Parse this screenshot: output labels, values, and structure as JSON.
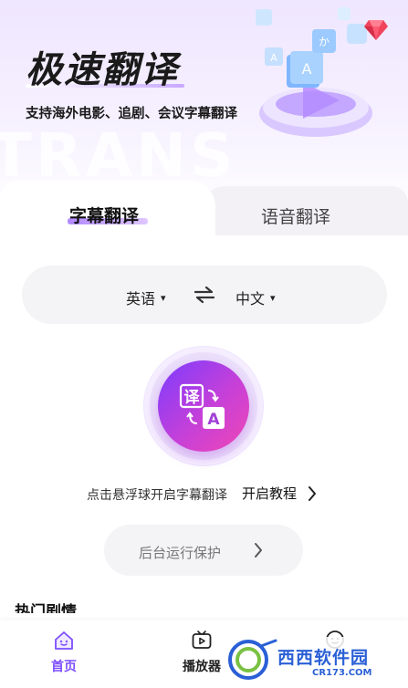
{
  "hero": {
    "title": "极速翻译",
    "subtitle": "支持海外电影、追剧、会议字幕翻译",
    "watermark": "TRANS",
    "illustration_glyphs": [
      "A",
      "か",
      "A"
    ]
  },
  "tabs": [
    {
      "label": "字幕翻译",
      "active": true
    },
    {
      "label": "语音翻译",
      "active": false
    }
  ],
  "languages": {
    "source": "英语",
    "target": "中文",
    "caret": "▾",
    "swap_icon": "swap-arrows-icon"
  },
  "float_button": {
    "icon": "translate-icon",
    "glyph_top": "译",
    "glyph_bottom": "A"
  },
  "hint": {
    "text": "点击悬浮球开启字幕翻译",
    "tutorial_label": "开启教程"
  },
  "background_protection": {
    "label": "后台运行保护"
  },
  "section": {
    "title": "热门剧情"
  },
  "nav": [
    {
      "label": "首页",
      "icon": "home-icon",
      "active": true
    },
    {
      "label": "播放器",
      "icon": "player-icon",
      "active": false
    },
    {
      "label": "",
      "icon": "profile-icon",
      "active": false
    }
  ],
  "watermark_logo": {
    "text": "西西软件园",
    "sub": "CR173.COM"
  },
  "colors": {
    "accent": "#7b4dff",
    "button_gradient_start": "#7b3cff",
    "button_gradient_end": "#f047b5",
    "hero_bg": "#efe6ff"
  }
}
